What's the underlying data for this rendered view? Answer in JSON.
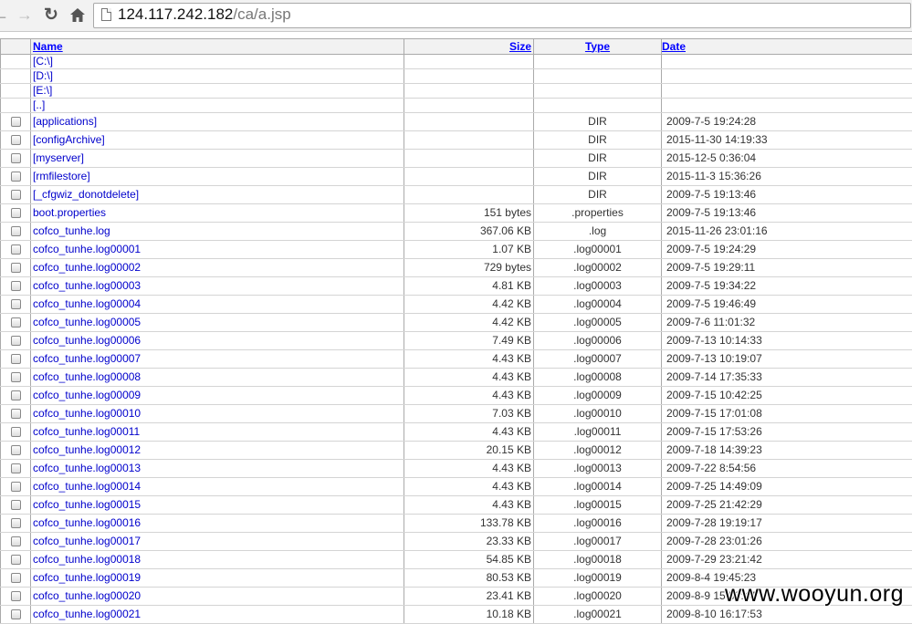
{
  "browser": {
    "back_icon": "arrow-left-icon",
    "forward_icon": "arrow-right-icon",
    "reload_icon": "reload-icon",
    "home_icon": "home-icon",
    "url_host": "124.117.242.182",
    "url_path": "/ca/a.jsp"
  },
  "table": {
    "headers": {
      "name": "Name",
      "size": "Size",
      "type": "Type",
      "date": "Date"
    },
    "drives": [
      "[C:\\]",
      "[D:\\]",
      "[E:\\]",
      "[..]"
    ],
    "rows": [
      {
        "name": "[applications]",
        "size": "",
        "type": "DIR",
        "date": "2009-7-5 19:24:28"
      },
      {
        "name": "[configArchive]",
        "size": "",
        "type": "DIR",
        "date": "2015-11-30 14:19:33"
      },
      {
        "name": "[myserver]",
        "size": "",
        "type": "DIR",
        "date": "2015-12-5 0:36:04"
      },
      {
        "name": "[rmfilestore]",
        "size": "",
        "type": "DIR",
        "date": "2015-11-3 15:36:26"
      },
      {
        "name": "[_cfgwiz_donotdelete]",
        "size": "",
        "type": "DIR",
        "date": "2009-7-5 19:13:46"
      },
      {
        "name": "boot.properties",
        "size": "151 bytes",
        "type": ".properties",
        "date": "2009-7-5 19:13:46"
      },
      {
        "name": "cofco_tunhe.log",
        "size": "367.06 KB",
        "type": ".log",
        "date": "2015-11-26 23:01:16"
      },
      {
        "name": "cofco_tunhe.log00001",
        "size": "1.07 KB",
        "type": ".log00001",
        "date": "2009-7-5 19:24:29"
      },
      {
        "name": "cofco_tunhe.log00002",
        "size": "729 bytes",
        "type": ".log00002",
        "date": "2009-7-5 19:29:11"
      },
      {
        "name": "cofco_tunhe.log00003",
        "size": "4.81 KB",
        "type": ".log00003",
        "date": "2009-7-5 19:34:22"
      },
      {
        "name": "cofco_tunhe.log00004",
        "size": "4.42 KB",
        "type": ".log00004",
        "date": "2009-7-5 19:46:49"
      },
      {
        "name": "cofco_tunhe.log00005",
        "size": "4.42 KB",
        "type": ".log00005",
        "date": "2009-7-6 11:01:32"
      },
      {
        "name": "cofco_tunhe.log00006",
        "size": "7.49 KB",
        "type": ".log00006",
        "date": "2009-7-13 10:14:33"
      },
      {
        "name": "cofco_tunhe.log00007",
        "size": "4.43 KB",
        "type": ".log00007",
        "date": "2009-7-13 10:19:07"
      },
      {
        "name": "cofco_tunhe.log00008",
        "size": "4.43 KB",
        "type": ".log00008",
        "date": "2009-7-14 17:35:33"
      },
      {
        "name": "cofco_tunhe.log00009",
        "size": "4.43 KB",
        "type": ".log00009",
        "date": "2009-7-15 10:42:25"
      },
      {
        "name": "cofco_tunhe.log00010",
        "size": "7.03 KB",
        "type": ".log00010",
        "date": "2009-7-15 17:01:08"
      },
      {
        "name": "cofco_tunhe.log00011",
        "size": "4.43 KB",
        "type": ".log00011",
        "date": "2009-7-15 17:53:26"
      },
      {
        "name": "cofco_tunhe.log00012",
        "size": "20.15 KB",
        "type": ".log00012",
        "date": "2009-7-18 14:39:23"
      },
      {
        "name": "cofco_tunhe.log00013",
        "size": "4.43 KB",
        "type": ".log00013",
        "date": "2009-7-22 8:54:56"
      },
      {
        "name": "cofco_tunhe.log00014",
        "size": "4.43 KB",
        "type": ".log00014",
        "date": "2009-7-25 14:49:09"
      },
      {
        "name": "cofco_tunhe.log00015",
        "size": "4.43 KB",
        "type": ".log00015",
        "date": "2009-7-25 21:42:29"
      },
      {
        "name": "cofco_tunhe.log00016",
        "size": "133.78 KB",
        "type": ".log00016",
        "date": "2009-7-28 19:19:17"
      },
      {
        "name": "cofco_tunhe.log00017",
        "size": "23.33 KB",
        "type": ".log00017",
        "date": "2009-7-28 23:01:26"
      },
      {
        "name": "cofco_tunhe.log00018",
        "size": "54.85 KB",
        "type": ".log00018",
        "date": "2009-7-29 23:21:42"
      },
      {
        "name": "cofco_tunhe.log00019",
        "size": "80.53 KB",
        "type": ".log00019",
        "date": "2009-8-4 19:45:23"
      },
      {
        "name": "cofco_tunhe.log00020",
        "size": "23.41 KB",
        "type": ".log00020",
        "date": "2009-8-9 15:58:44"
      },
      {
        "name": "cofco_tunhe.log00021",
        "size": "10.18 KB",
        "type": ".log00021",
        "date": "2009-8-10 16:17:53"
      }
    ]
  },
  "watermark": "www.wooyun.org"
}
